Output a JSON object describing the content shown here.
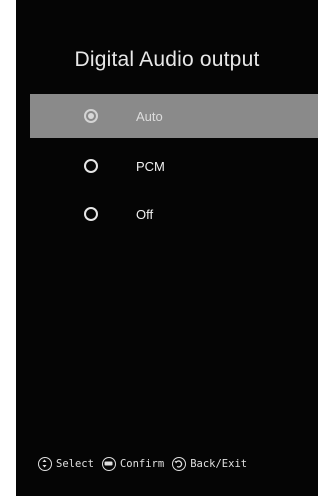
{
  "menu": {
    "title": "Digital Audio output",
    "options": [
      {
        "label": "Auto",
        "selected": true
      },
      {
        "label": "PCM",
        "selected": false
      },
      {
        "label": "Off",
        "selected": false
      }
    ]
  },
  "footer": {
    "select_label": "Select",
    "confirm_label": "Confirm",
    "back_label": "Back/Exit"
  },
  "colors": {
    "background": "#050505",
    "highlight": "#8a8a8a",
    "text": "#e8e8e8"
  }
}
